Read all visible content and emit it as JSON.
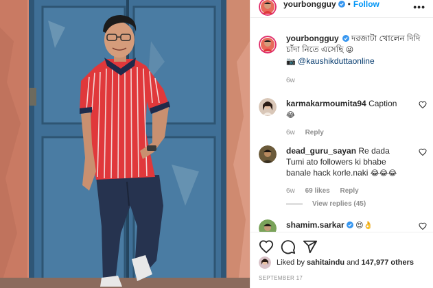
{
  "post": {
    "photo_alt": "",
    "photo_colors": {
      "wall": "#d98b73",
      "door": "#3f6f96",
      "shirt": "#e0383b",
      "jeans": "#26334f"
    }
  },
  "header": {
    "username": "yourbongguy",
    "separator": "•",
    "follow_label": "Follow",
    "more_label": "•••"
  },
  "caption": {
    "username": "yourbongguy",
    "text": "দরজাটা খোলেন দিদি চাঁদা নিতে এসেছি",
    "emoji": "😜",
    "camera_icon": "📷",
    "credit": "@kaushikduttaonline",
    "time": "6w"
  },
  "comments": [
    {
      "username": "karmakarmoumita94",
      "text": "Caption",
      "emoji": "😂",
      "time": "6w",
      "reply_label": "Reply"
    },
    {
      "username": "dead_guru_sayan",
      "text": "Re dada Tumi ato followers ki bhabe banale hack korle.naki",
      "emoji": "😂😂😂",
      "time": "6w",
      "likes": "69 likes",
      "reply_label": "Reply",
      "view_replies": "View replies (45)"
    },
    {
      "username": "shamim.sarkar",
      "emoji": "😍👌"
    }
  ],
  "footer": {
    "liked_prefix": "Liked by ",
    "liked_user": "sahitaindu",
    "liked_suffix": " and ",
    "liked_count": "147,977 others",
    "date": "SEPTEMBER 17"
  },
  "colors": {
    "accent": "#0095f6",
    "verified": "#3897f0",
    "muted": "#8e8e8e"
  },
  "icons": [
    "heart-icon",
    "comment-icon",
    "share-icon",
    "verified-icon",
    "more-icon",
    "camera-icon"
  ]
}
